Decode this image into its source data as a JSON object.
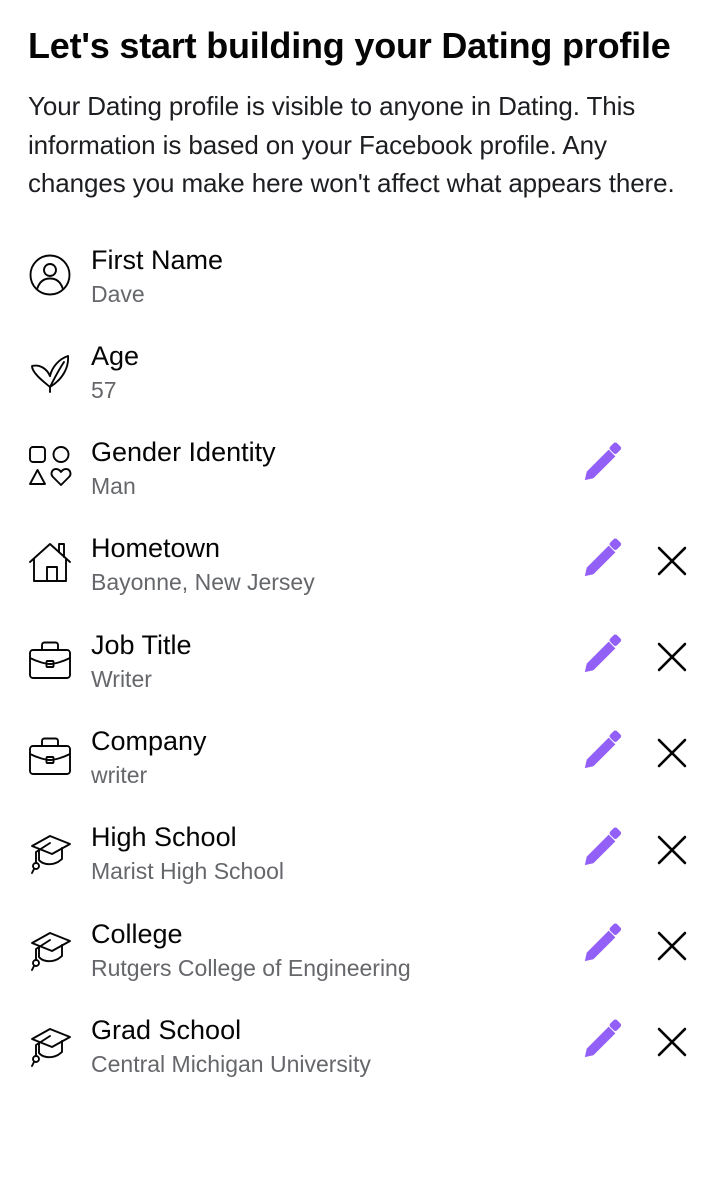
{
  "header": {
    "title": "Let's start building your Dating profile",
    "description": "Your Dating profile is visible to anyone in Dating. This information is based on your Facebook profile. Any changes you make here won't affect what appears there."
  },
  "colors": {
    "accent": "#9360F7",
    "label": "#050505",
    "value": "#65676b"
  },
  "fields": [
    {
      "label": "First Name",
      "value": "Dave",
      "icon": "person-circle-icon",
      "editable": false,
      "removable": false
    },
    {
      "label": "Age",
      "value": "57",
      "icon": "leaf-icon",
      "editable": false,
      "removable": false
    },
    {
      "label": "Gender Identity",
      "value": "Man",
      "icon": "shapes-icon",
      "editable": true,
      "removable": false
    },
    {
      "label": "Hometown",
      "value": "Bayonne, New Jersey",
      "icon": "house-icon",
      "editable": true,
      "removable": true
    },
    {
      "label": "Job Title",
      "value": "Writer",
      "icon": "briefcase-icon",
      "editable": true,
      "removable": true
    },
    {
      "label": "Company",
      "value": "writer",
      "icon": "briefcase-icon",
      "editable": true,
      "removable": true
    },
    {
      "label": "High School",
      "value": "Marist High School",
      "icon": "graduation-cap-icon",
      "editable": true,
      "removable": true
    },
    {
      "label": "College",
      "value": "Rutgers College of Engineering",
      "icon": "graduation-cap-icon",
      "editable": true,
      "removable": true
    },
    {
      "label": "Grad School",
      "value": "Central Michigan University",
      "icon": "graduation-cap-icon",
      "editable": true,
      "removable": true
    }
  ]
}
